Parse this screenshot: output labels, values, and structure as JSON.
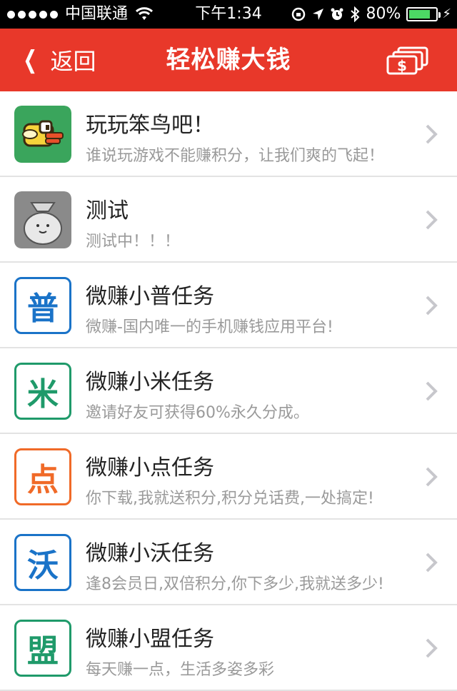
{
  "status_bar": {
    "carrier": "中国联通",
    "time": "下午1:34",
    "battery_percent": "80%",
    "battery_level": 0.8,
    "signal_dots": 5
  },
  "nav": {
    "back_label": "返回",
    "title": "轻松赚大钱",
    "right_icon": "money-bills-icon",
    "accent_color": "#e8382a"
  },
  "tasks": [
    {
      "title": "玩玩笨鸟吧！",
      "subtitle": "谁说玩游戏不能赚积分，让我们爽的飞起！",
      "icon": "flappy-bird-icon"
    },
    {
      "title": "测试",
      "subtitle": "测试中！！！",
      "icon": "money-bag-icon"
    },
    {
      "title": "微赚小普任务",
      "subtitle": "微赚-国内唯一的手机赚钱应用平台!",
      "icon_char": "普",
      "color": "#1a73c8"
    },
    {
      "title": "微赚小米任务",
      "subtitle": "邀请好友可获得60%永久分成。",
      "icon_char": "米",
      "color": "#1f9a6a"
    },
    {
      "title": "微赚小点任务",
      "subtitle": "你下载,我就送积分,积分兑话费,一处搞定!",
      "icon_char": "点",
      "color": "#f06a28"
    },
    {
      "title": "微赚小沃任务",
      "subtitle": "逢8会员日,双倍积分,你下多少,我就送多少!",
      "icon_char": "沃",
      "color": "#1a73c8"
    },
    {
      "title": "微赚小盟任务",
      "subtitle": "每天赚一点，生活多姿多彩",
      "icon_char": "盟",
      "color": "#1f9a6a"
    }
  ]
}
